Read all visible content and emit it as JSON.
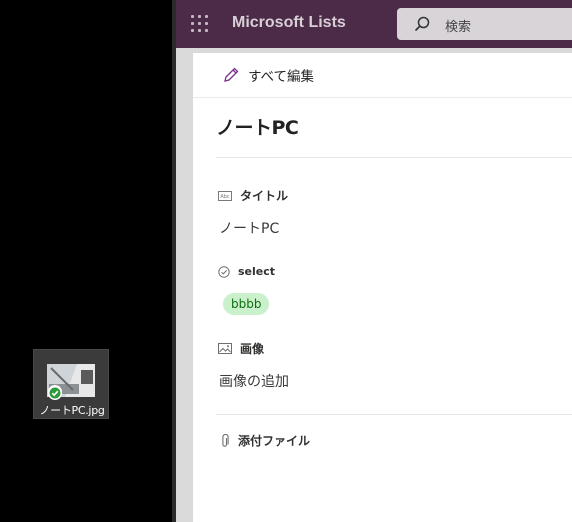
{
  "desktop": {
    "file_icon_label": "ノートPC.jpg"
  },
  "suite_bar": {
    "app_name": "Microsoft Lists",
    "search_placeholder": "検索"
  },
  "panel": {
    "edit_all_label": "すべて編集",
    "item_title": "ノートPC",
    "fields": {
      "title": {
        "label": "タイトル",
        "value": "ノートPC"
      },
      "select": {
        "label": "select",
        "value": "bbbb"
      },
      "image": {
        "label": "画像",
        "value": "画像の追加"
      },
      "attachments": {
        "label": "添付ファイル"
      }
    }
  },
  "colors": {
    "suite_bar": "#4b2b47",
    "pill_bg": "#caf0cc",
    "pill_text": "#0e700e",
    "accent_pencil": "#7c2e8a"
  }
}
